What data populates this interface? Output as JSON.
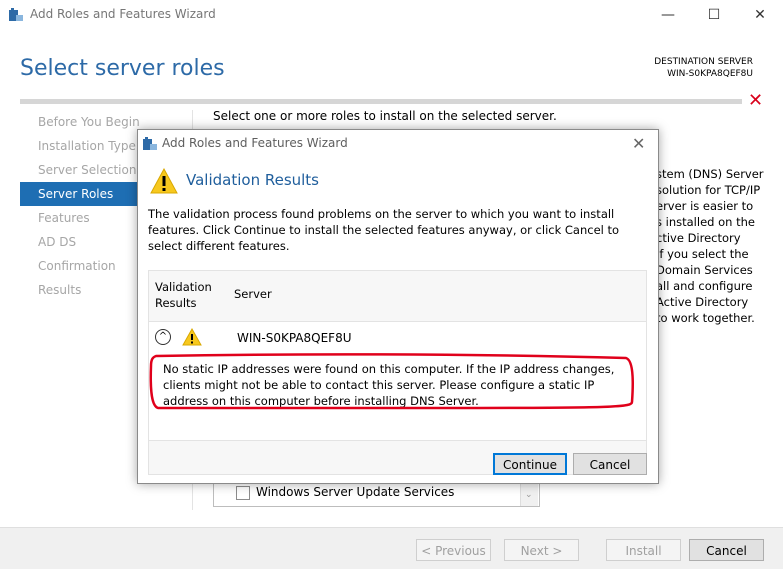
{
  "window": {
    "title": "Add Roles and Features Wizard",
    "minimize_glyph": "—",
    "maximize_glyph": "☐",
    "close_glyph": "✕"
  },
  "header": {
    "page_title": "Select server roles",
    "destination_label": "DESTINATION SERVER",
    "destination_server": "WIN-S0KPA8QEF8U",
    "error_glyph": "✕"
  },
  "nav": {
    "items": [
      {
        "label": "Before You Begin",
        "active": false
      },
      {
        "label": "Installation Type",
        "active": false
      },
      {
        "label": "Server Selection",
        "active": false
      },
      {
        "label": "Server Roles",
        "active": true
      },
      {
        "label": "Features",
        "active": false
      },
      {
        "label": "AD DS",
        "active": false
      },
      {
        "label": "Confirmation",
        "active": false
      },
      {
        "label": "Results",
        "active": false
      }
    ]
  },
  "content": {
    "intro": "Select one or more roles to install on the selected server.",
    "description_lines": [
      "stem (DNS) Server",
      "solution for TCP/IP",
      "erver is easier to",
      "s installed on the",
      "ctive Directory",
      "If you select the",
      "Domain Services",
      "all and configure",
      "Active Directory",
      "to work together."
    ],
    "wsus_label": "Windows Server Update Services"
  },
  "footer": {
    "previous": "< Previous",
    "next": "Next >",
    "install": "Install",
    "cancel": "Cancel"
  },
  "dialog": {
    "title": "Add Roles and Features Wizard",
    "close_glyph": "✕",
    "heading": "Validation Results",
    "description": "The validation process found problems on the server to which you want to install features. Click Continue to install the selected features anyway, or click Cancel to select different features.",
    "col_results_line1": "Validation",
    "col_results_line2": "Results",
    "col_server": "Server",
    "expand_glyph": "^",
    "row_server": "WIN-S0KPA8QEF8U",
    "row_message": "No static IP addresses were found on this computer. If the IP address changes, clients might not be able to contact this server. Please configure a static IP address on this computer before installing DNS Server.",
    "continue": "Continue",
    "cancel": "Cancel"
  },
  "colors": {
    "accent": "#1e6eb3",
    "title_blue": "#2d6aa7",
    "annotation_red": "#e0001b",
    "warning_yellow": "#f7c81e"
  }
}
